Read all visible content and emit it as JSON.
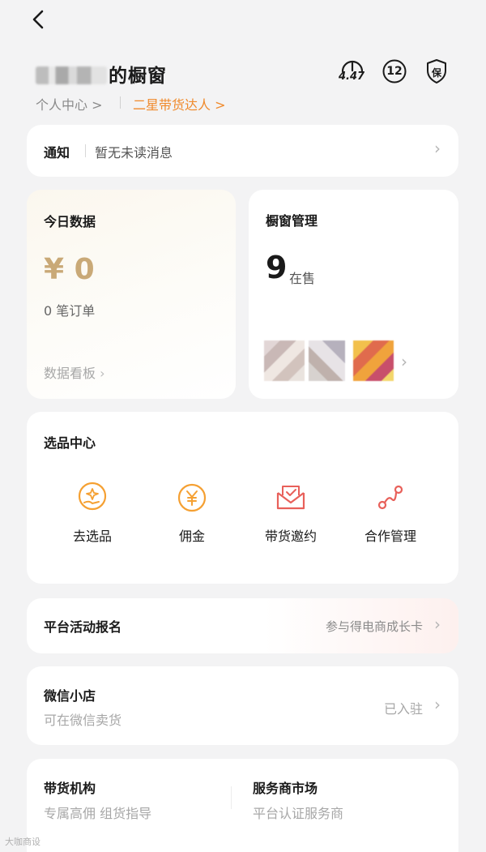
{
  "header": {
    "title_suffix": "的橱窗",
    "personal_center": "个人中心 >",
    "level_label": "二星带货达人 >",
    "score": "4.47",
    "badge_count": "12",
    "shield_label": "保"
  },
  "notice": {
    "label": "通知",
    "text": "暂无未读消息"
  },
  "today": {
    "title": "今日数据",
    "amount": "¥ 0",
    "orders": "0 笔订单",
    "dashboard_link": "数据看板"
  },
  "showcase": {
    "title": "橱窗管理",
    "count": "9",
    "count_label": "在售"
  },
  "selection": {
    "title": "选品中心",
    "items": [
      {
        "label": "去选品",
        "icon": "hand-star-icon"
      },
      {
        "label": "佣金",
        "icon": "yen-coin-icon"
      },
      {
        "label": "带货邀约",
        "icon": "envelope-icon"
      },
      {
        "label": "合作管理",
        "icon": "collab-nodes-icon"
      }
    ]
  },
  "platform": {
    "title": "平台活动报名",
    "link": "参与得电商成长卡"
  },
  "wechat_shop": {
    "title": "微信小店",
    "subtitle": "可在微信卖货",
    "status": "已入驻"
  },
  "agency": {
    "title": "带货机构",
    "subtitle": "专属高佣 组货指导"
  },
  "service_market": {
    "title": "服务商市场",
    "subtitle": "平台认证服务商"
  },
  "watermark": "大咖商设",
  "colors": {
    "accent": "#f08a2c",
    "background": "#f3f3f4",
    "card": "#ffffff",
    "today_amount": "#c9a977",
    "icon_orange": "#f5a032",
    "icon_red": "#e8605a"
  }
}
